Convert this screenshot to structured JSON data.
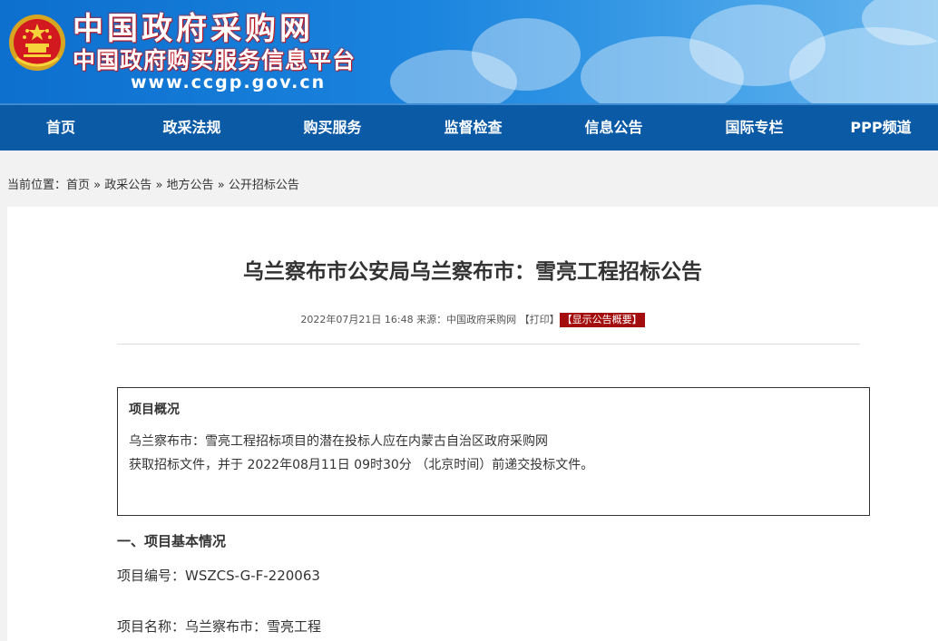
{
  "header": {
    "site_name": "中国政府采购网",
    "site_subtitle": "中国政府购买服务信息平台",
    "site_url": "www.ccgp.gov.cn",
    "emblem_icon": "national-emblem-icon",
    "colors": {
      "banner": "#1a84de",
      "nav": "#0b5aa6",
      "accent_red": "#a30d0d"
    }
  },
  "nav": {
    "items": [
      "首页",
      "政采法规",
      "购买服务",
      "监督检查",
      "信息公告",
      "国际专栏",
      "PPP频道"
    ]
  },
  "breadcrumb": {
    "prefix": "当前位置：",
    "items": [
      "首页",
      "政采公告",
      "地方公告",
      "公开招标公告"
    ],
    "separator": "»"
  },
  "article": {
    "title": "乌兰察布市公安局乌兰察布市：雪亮工程招标公告",
    "meta_datetime": "2022年07月21日 16:48",
    "meta_source_label": "来源：",
    "meta_source": "中国政府采购网",
    "print_label": "【打印】",
    "summary_label": "【显示公告概要】"
  },
  "overview": {
    "title": "项目概况",
    "line1": "乌兰察布市：雪亮工程招标项目的潜在投标人应在内蒙古自治区政府采购网",
    "line2": "获取招标文件，并于 2022年08月11日 09时30分 （北京时间）前递交投标文件。"
  },
  "basic_info": {
    "heading": "一、项目基本情况",
    "project_no_label": "项目编号：",
    "project_no": "WSZCS-G-F-220063",
    "project_name_label": "项目名称：",
    "project_name": "乌兰察布市：雪亮工程"
  }
}
